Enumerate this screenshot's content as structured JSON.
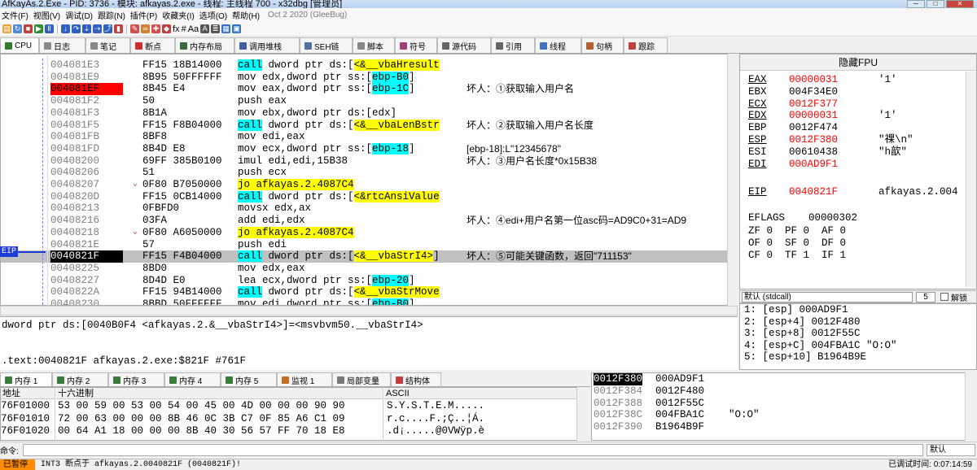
{
  "window": {
    "title": "AfKayAs.2.Exe - PID: 3736 - 模块: afkayas.2.exe - 线程: 主线程 700 - x32dbg [管理员]",
    "controls": [
      "─",
      "□",
      "✕"
    ]
  },
  "menu": {
    "items": [
      "文件(F)",
      "视图(V)",
      "调试(D)",
      "跟踪(N)",
      "插件(P)",
      "收藏夹(I)",
      "选项(O)",
      "帮助(H)"
    ],
    "version": "Oct 2 2020 (GleeBug)"
  },
  "toolbar_icons": [
    {
      "name": "open-icon",
      "color": "#e6a23c",
      "glyph": "▤"
    },
    {
      "name": "restart-icon",
      "color": "#4a8ad8",
      "glyph": "↻"
    },
    {
      "name": "close-debug-icon",
      "color": "#c04040",
      "glyph": "■"
    },
    {
      "name": "run-icon",
      "color": "#2f8f2f",
      "glyph": "▶"
    },
    {
      "name": "pause-icon",
      "color": "#3060c0",
      "glyph": "Ⅱ"
    },
    {
      "name": "step-into-icon",
      "color": "#3060c0",
      "glyph": "↓"
    },
    {
      "name": "step-over-icon",
      "color": "#3060c0",
      "glyph": "↷"
    },
    {
      "name": "trace-into-icon",
      "color": "#3060c0",
      "glyph": "⇣"
    },
    {
      "name": "trace-over-icon",
      "color": "#3060c0",
      "glyph": "⇢"
    },
    {
      "name": "execute-till-return-icon",
      "color": "#3060c0",
      "glyph": "⤴"
    },
    {
      "name": "run-to-user-icon",
      "color": "#c04040",
      "glyph": "▮"
    },
    {
      "name": "pen-icon",
      "color": "#d05050",
      "glyph": "✎"
    },
    {
      "name": "link-icon",
      "color": "#d08030",
      "glyph": "∞"
    },
    {
      "name": "patch-icon",
      "color": "#d05050",
      "glyph": "✚"
    },
    {
      "name": "tag-icon",
      "color": "#c04040",
      "glyph": "◆"
    },
    {
      "name": "font-icon",
      "color": "#555555",
      "glyph": "A"
    },
    {
      "name": "list-icon",
      "color": "#555555",
      "glyph": "≣"
    },
    {
      "name": "calc-icon",
      "color": "#3070c0",
      "glyph": "▦"
    },
    {
      "name": "script-icon",
      "color": "#3070c0",
      "glyph": "▣"
    }
  ],
  "toolbar_text": {
    "fx": "fx",
    "hash": "#",
    "aa": "Aa"
  },
  "tabs": [
    {
      "label": "CPU",
      "color": "#2f7f2f",
      "active": true
    },
    {
      "label": "日志",
      "color": "#888888",
      "active": false
    },
    {
      "label": "笔记",
      "color": "#888888",
      "active": false
    },
    {
      "label": "断点",
      "color": "#d03030",
      "active": false
    },
    {
      "label": "内存布局",
      "color": "#3a6a3a",
      "active": false
    },
    {
      "label": "调用堆栈",
      "color": "#4060a0",
      "active": false
    },
    {
      "label": "SEH链",
      "color": "#5070a0",
      "active": false
    },
    {
      "label": "脚本",
      "color": "#888888",
      "active": false
    },
    {
      "label": "符号",
      "color": "#a04070",
      "active": false
    },
    {
      "label": "源代码",
      "color": "#666666",
      "active": false
    },
    {
      "label": "引用",
      "color": "#666666",
      "active": false
    },
    {
      "label": "线程",
      "color": "#4070c0",
      "active": false
    },
    {
      "label": "句柄",
      "color": "#b06030",
      "active": false
    },
    {
      "label": "跟踪",
      "color": "#c04040",
      "active": false
    }
  ],
  "disasm": [
    {
      "addr": "004081E3",
      "bytes": "FF15 18B14000",
      "instr": [
        {
          "t": "call",
          "c": "kcall"
        },
        {
          "t": " dword ptr ds:[",
          "c": ""
        },
        {
          "t": "<&__vbaHresult",
          "c": "ylw"
        }
      ],
      "comment": "",
      "flag": ""
    },
    {
      "addr": "004081E9",
      "bytes": "8B95 50FFFFFF",
      "instr": [
        {
          "t": "mov edx,dword ptr ss:[",
          "c": ""
        },
        {
          "t": "ebp-B0",
          "c": "cyn"
        },
        {
          "t": "]",
          "c": ""
        }
      ],
      "comment": "",
      "flag": ""
    },
    {
      "addr": "004081EF",
      "bytes": "8B45 E4",
      "instr": [
        {
          "t": "mov eax,dword ptr ss:[",
          "c": ""
        },
        {
          "t": "ebp-1C",
          "c": "cyn"
        },
        {
          "t": "]",
          "c": ""
        }
      ],
      "comment": "坏人：①获取输入用户名",
      "flag": "bp"
    },
    {
      "addr": "004081F2",
      "bytes": "50",
      "instr": [
        {
          "t": "push eax",
          "c": ""
        }
      ],
      "comment": "",
      "flag": ""
    },
    {
      "addr": "004081F3",
      "bytes": "8B1A",
      "instr": [
        {
          "t": "mov ebx,dword ptr ds:[edx]",
          "c": ""
        }
      ],
      "comment": "",
      "flag": ""
    },
    {
      "addr": "004081F5",
      "bytes": "FF15 F8B04000",
      "instr": [
        {
          "t": "call",
          "c": "kcall"
        },
        {
          "t": " dword ptr ds:[",
          "c": ""
        },
        {
          "t": "<&__vbaLenBstr",
          "c": "ylw"
        }
      ],
      "comment": "坏人：②获取输入用户名长度",
      "flag": ""
    },
    {
      "addr": "004081FB",
      "bytes": "8BF8",
      "instr": [
        {
          "t": "mov edi,eax",
          "c": ""
        }
      ],
      "comment": "",
      "flag": ""
    },
    {
      "addr": "004081FD",
      "bytes": "8B4D E8",
      "instr": [
        {
          "t": "mov ecx,dword ptr ss:[",
          "c": ""
        },
        {
          "t": "ebp-18",
          "c": "cyn"
        },
        {
          "t": "]",
          "c": ""
        }
      ],
      "comment": "[ebp-18]:L\"12345678\"",
      "flag": "",
      "cclass": "mag"
    },
    {
      "addr": "00408200",
      "bytes": "69FF 385B0100",
      "instr": [
        {
          "t": "imul edi,edi,15B38",
          "c": ""
        }
      ],
      "comment": "坏人：③用户名长度*0x15B38",
      "flag": ""
    },
    {
      "addr": "00408206",
      "bytes": "51",
      "instr": [
        {
          "t": "push ecx",
          "c": ""
        }
      ],
      "comment": "",
      "flag": ""
    },
    {
      "addr": "00408207",
      "bytes": "0F80 B7050000",
      "instr": [
        {
          "t": "jo",
          "c": "kjmp"
        },
        {
          "t": " afkayas.2.4087C4",
          "c": "ylw"
        }
      ],
      "comment": "",
      "flag": "",
      "arrow": "⌄"
    },
    {
      "addr": "0040820D",
      "bytes": "FF15 0CB14000",
      "instr": [
        {
          "t": "call",
          "c": "kcall"
        },
        {
          "t": " dword ptr ds:[",
          "c": ""
        },
        {
          "t": "<&rtcAnsiValue",
          "c": "ylw"
        }
      ],
      "comment": "",
      "flag": ""
    },
    {
      "addr": "00408213",
      "bytes": "0FBFD0",
      "instr": [
        {
          "t": "movsx edx,ax",
          "c": ""
        }
      ],
      "comment": "",
      "flag": ""
    },
    {
      "addr": "00408216",
      "bytes": "03FA",
      "instr": [
        {
          "t": "add edi,edx",
          "c": ""
        }
      ],
      "comment": "坏人：④edi+用户名第一位asc码=AD9C0+31=AD9",
      "flag": ""
    },
    {
      "addr": "00408218",
      "bytes": "0F80 A6050000",
      "instr": [
        {
          "t": "jo",
          "c": "kjmp"
        },
        {
          "t": " afkayas.2.4087C4",
          "c": "ylw"
        }
      ],
      "comment": "",
      "flag": "",
      "arrow": "⌄"
    },
    {
      "addr": "0040821E",
      "bytes": "57",
      "instr": [
        {
          "t": "push edi",
          "c": ""
        }
      ],
      "comment": "",
      "flag": ""
    },
    {
      "addr": "0040821F",
      "bytes": "FF15 F4B04000",
      "instr": [
        {
          "t": "call",
          "c": "kcall"
        },
        {
          "t": " dword ptr ds:[",
          "c": ""
        },
        {
          "t": "<&__vbaStrI4>",
          "c": "ylw"
        },
        {
          "t": "]",
          "c": ""
        }
      ],
      "comment": "坏人：⑤可能关键函数，返回\"711153\"",
      "flag": "eip"
    },
    {
      "addr": "00408225",
      "bytes": "8BD0",
      "instr": [
        {
          "t": "mov edx,eax",
          "c": ""
        }
      ],
      "comment": "",
      "flag": ""
    },
    {
      "addr": "00408227",
      "bytes": "8D4D E0",
      "instr": [
        {
          "t": "lea ecx,dword ptr ss:[",
          "c": ""
        },
        {
          "t": "ebp-20",
          "c": "cyn"
        },
        {
          "t": "]",
          "c": ""
        }
      ],
      "comment": "",
      "flag": ""
    },
    {
      "addr": "0040822A",
      "bytes": "FF15 94B14000",
      "instr": [
        {
          "t": "call",
          "c": "kcall"
        },
        {
          "t": " dword ptr ds:[",
          "c": ""
        },
        {
          "t": "<&__vbaStrMove",
          "c": "ylw"
        }
      ],
      "comment": "",
      "flag": ""
    },
    {
      "addr": "00408230",
      "bytes": "8BBD 50FFFFFF",
      "instr": [
        {
          "t": "mov edi,dword ptr ss:[",
          "c": ""
        },
        {
          "t": "ebp-B0",
          "c": "cyn"
        },
        {
          "t": "]",
          "c": ""
        }
      ],
      "comment": "",
      "flag": ""
    }
  ],
  "eip_label": "EIP",
  "info": {
    "line1": "dword ptr ds:[0040B0F4 <afkayas.2.&__vbaStrI4>]=<msvbvm50.__vbaStrI4>",
    "line2": ".text:0040821F afkayas.2.exe:$821F #761F"
  },
  "regs_header": "隐藏FPU",
  "registers": [
    {
      "name": "EAX",
      "value": "00000031",
      "comment": "'1'",
      "changed": true
    },
    {
      "name": "EBX",
      "value": "004F34E0",
      "comment": "",
      "changed": false
    },
    {
      "name": "ECX",
      "value": "0012F377",
      "comment": "",
      "changed": true
    },
    {
      "name": "EDX",
      "value": "00000031",
      "comment": "'1'",
      "changed": true
    },
    {
      "name": "EBP",
      "value": "0012F474",
      "comment": "",
      "changed": false
    },
    {
      "name": "ESP",
      "value": "0012F380",
      "comment": "\"祼\\n\"",
      "changed": true
    },
    {
      "name": "ESI",
      "value": "00610438",
      "comment": "\"h歆\"",
      "changed": false
    },
    {
      "name": "EDI",
      "value": "000AD9F1",
      "comment": "",
      "changed": true
    }
  ],
  "eip_reg": {
    "name": "EIP",
    "value": "0040821F",
    "comment": "afkayas.2.004"
  },
  "eflags": {
    "label": "EFLAGS",
    "value": "00000302"
  },
  "flags": [
    "ZF 0  PF 0  AF 0",
    "OF 0  SF 0  DF 0",
    "CF 0  TF 1  IF 1"
  ],
  "callconv": {
    "value": "默认 (stdcall)",
    "count": "5",
    "unlock": "解锁"
  },
  "args": [
    "1: [esp] 000AD9F1",
    "2: [esp+4] 0012F480",
    "3: [esp+8] 0012F55C",
    "4: [esp+C] 004FBA1C \"O:O\"",
    "5: [esp+10] B1964B9E"
  ],
  "dump_tabs": [
    {
      "label": "内存 1",
      "color": "#3a7a3a"
    },
    {
      "label": "内存 2",
      "color": "#3a7a3a"
    },
    {
      "label": "内存 3",
      "color": "#3a7a3a"
    },
    {
      "label": "内存 4",
      "color": "#3a7a3a"
    },
    {
      "label": "内存 5",
      "color": "#3a7a3a"
    },
    {
      "label": "监视 1",
      "color": "#c07020"
    },
    {
      "label": "局部变量",
      "color": "#777777"
    },
    {
      "label": "结构体",
      "color": "#c04040"
    }
  ],
  "dump_headers": {
    "addr": "地址",
    "hex": "十六进制",
    "ascii": "ASCII"
  },
  "dump_rows": [
    {
      "addr": "76F01000",
      "hex": "53 00 59 00 53 00 54 00 45 00 4D 00 00 00 90 90",
      "ascii": "S.Y.S.T.E.M....."
    },
    {
      "addr": "76F01010",
      "hex": "72 00 63 00 00 00 8B 46 0C 3B C7 0F 85 A6 C1 09",
      "ascii": "r.c....F.;Ç..¦Á."
    },
    {
      "addr": "76F01020",
      "hex": "00 64 A1 18 00 00 00 8B 40 30 56 57 FF 70 18 E8",
      "ascii": ".d¡.....@0VWÿp.è"
    }
  ],
  "stack": [
    {
      "addr": "0012F380",
      "value": "000AD9F1",
      "comment": "",
      "top": true
    },
    {
      "addr": "0012F384",
      "value": "0012F480",
      "comment": "",
      "top": false
    },
    {
      "addr": "0012F388",
      "value": "0012F55C",
      "comment": "",
      "top": false
    },
    {
      "addr": "0012F38C",
      "value": "004FBA1C",
      "comment": "\"O:O\"",
      "top": false
    },
    {
      "addr": "0012F390",
      "value": "B1964B9F",
      "comment": "",
      "top": false
    }
  ],
  "cmd": {
    "label": "命令:",
    "default": "默认"
  },
  "status": {
    "state": "已暂停",
    "message": "INT3 断点于 afkayas.2.0040821F (0040821F)!",
    "time": "已调试时间:  0:07:14:59"
  }
}
